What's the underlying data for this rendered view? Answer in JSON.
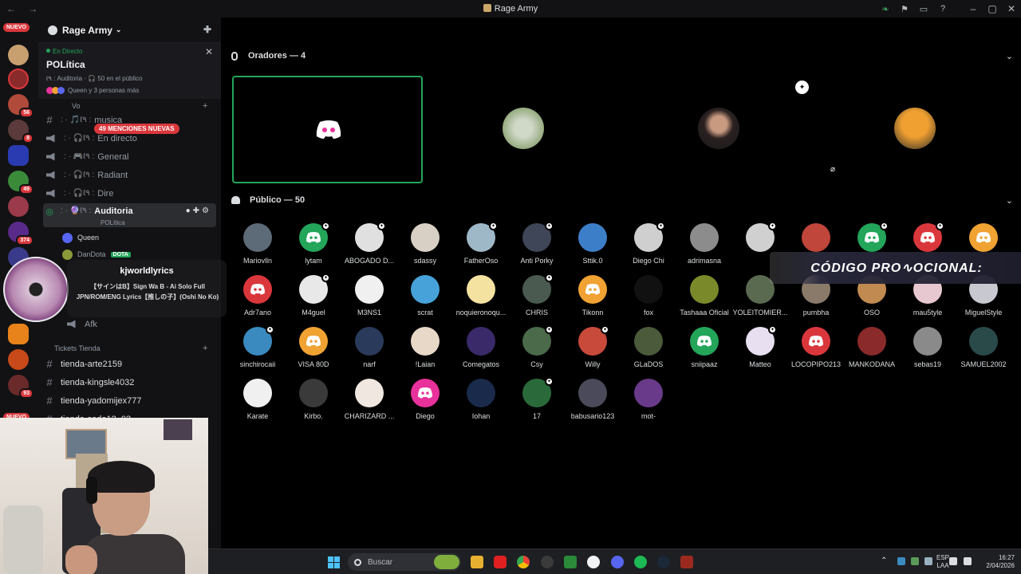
{
  "window": {
    "title": "Rage Army",
    "nav_arrows": "← →"
  },
  "guilds": {
    "nuevo_top": "NUEVO",
    "nuevo_bottom": "NUEVO",
    "badges": [
      "56",
      "8",
      "49",
      "374",
      "93"
    ]
  },
  "server": {
    "name": "Rage Army",
    "live": {
      "tag": "En Directo",
      "name": "POLítica",
      "info": "ℓ٩ : Auditoria · 🎧 50 en el público",
      "people": "Queen y 3 personas más"
    },
    "mentions_badge": "49 MENCIONES NUEVAS",
    "voice_category": "Vo",
    "channels": [
      {
        "prefix": ": · 🎵ℓ٩ :",
        "name": "musica"
      },
      {
        "prefix": ": · 🎧ℓ٩ :",
        "name": "En directo"
      },
      {
        "prefix": ": · 🎮ℓ٩ :",
        "name": "General"
      },
      {
        "prefix": ": · 🎧ℓ٩ :",
        "name": "Radiant"
      },
      {
        "prefix": ": · 🎧ℓ٩ :",
        "name": "Dire"
      },
      {
        "prefix": ": · 🔮ℓ٩ :",
        "name": "Auditoria",
        "sub": "POLítica"
      }
    ],
    "members": [
      {
        "name": "Queen"
      },
      {
        "name": "DanDota",
        "badge": "DOTA"
      }
    ],
    "afk_channel": "Afk",
    "tickets_category": "Tickets Tienda",
    "text_channels": [
      "tienda-arte2159",
      "tienda-kingsle4032",
      "tienda-yadomijex777",
      "tienda-sado12_03"
    ]
  },
  "now_playing": {
    "user": "kjworldlyrics",
    "song": "【サインはB】Sign Wa B - Ai Solo Full JPN/ROM/ENG Lyrics【推しの子】(Oshi No Ko)"
  },
  "stage": {
    "speakers_title": "Oradores — 4",
    "audience_title": "Público — 50",
    "speaker_colors": [
      "#e8319b",
      "#8fa144",
      "#c4aa86",
      "#c85e12"
    ],
    "audience": [
      {
        "name": "Mariovlln",
        "color": "#5d6a78",
        "star": false
      },
      {
        "name": "lytam",
        "color": "#23a55a",
        "star": true,
        "discord": true
      },
      {
        "name": "ABOGADO D...",
        "color": "#e0e0e0",
        "star": true
      },
      {
        "name": "sdassy",
        "color": "#d8d0c4",
        "star": false
      },
      {
        "name": "FatherOso",
        "color": "#9fb8c8",
        "star": true
      },
      {
        "name": "Anti Porky",
        "color": "#3f4658",
        "star": true
      },
      {
        "name": "Sttik.0",
        "color": "#3d7ec9",
        "star": false
      },
      {
        "name": "Diego Chi",
        "color": "#cfcfcf",
        "star": true
      },
      {
        "name": "adrimasna",
        "color": "#8c8c8c",
        "star": false
      },
      {
        "name": "",
        "color": "#d0d0d0",
        "star": true
      },
      {
        "name": "",
        "color": "#c0453a",
        "star": false
      },
      {
        "name": "",
        "color": "#23a55a",
        "star": true,
        "discord": true
      },
      {
        "name": "",
        "color": "#da373c",
        "star": true,
        "discord": true
      },
      {
        "name": "",
        "color": "#f0a232",
        "star": false,
        "discord": true
      },
      {
        "name": "Adr7ano",
        "color": "#da373c",
        "star": false,
        "discord": true
      },
      {
        "name": "M4guel",
        "color": "#e8e8e8",
        "star": true
      },
      {
        "name": "M3NS1",
        "color": "#f0f0f0",
        "star": false
      },
      {
        "name": "scrat",
        "color": "#46a2d8",
        "star": false
      },
      {
        "name": "noquieronoqu...",
        "color": "#f4e2a0",
        "star": false
      },
      {
        "name": "CHRIS",
        "color": "#4a5a50",
        "star": true
      },
      {
        "name": "Tikonn",
        "color": "#f0a232",
        "star": false,
        "discord": true
      },
      {
        "name": "fox",
        "color": "#111111",
        "star": false
      },
      {
        "name": "Tashaaa Oficial",
        "color": "#7a8a2a",
        "star": false
      },
      {
        "name": "YOLEITOMIER...",
        "color": "#5a6a50",
        "star": false
      },
      {
        "name": "pumbha",
        "color": "#8a7a6a",
        "star": false
      },
      {
        "name": "OSO",
        "color": "#c08a50",
        "star": false
      },
      {
        "name": "mau5tyle",
        "color": "#e8c8d0",
        "star": false
      },
      {
        "name": "MiguelStyle",
        "color": "#c8c8d0",
        "star": false
      },
      {
        "name": "sinchirocaii",
        "color": "#3a8ac0",
        "star": true
      },
      {
        "name": "VISA 80D",
        "color": "#f0a232",
        "star": false,
        "discord": true
      },
      {
        "name": "narf",
        "color": "#2a3a5a",
        "star": false
      },
      {
        "name": "!Laian",
        "color": "#e8d8c8",
        "star": false
      },
      {
        "name": "Comegatos",
        "color": "#3a2a6a",
        "star": false
      },
      {
        "name": "Csy",
        "color": "#4a6a4a",
        "star": true
      },
      {
        "name": "Willy",
        "color": "#c84a3a",
        "star": true
      },
      {
        "name": "GLaDOS",
        "color": "#4a5a3a",
        "star": false
      },
      {
        "name": "sniipaaz",
        "color": "#23a55a",
        "star": false,
        "discord": true
      },
      {
        "name": "Matteo",
        "color": "#e8e0f0",
        "star": true
      },
      {
        "name": "LOCOPIPO213",
        "color": "#da373c",
        "star": false,
        "discord": true
      },
      {
        "name": "MANKODANA",
        "color": "#8a2a2a",
        "star": false
      },
      {
        "name": "sebas19",
        "color": "#8a8a8a",
        "star": false
      },
      {
        "name": "SAMUEL2002",
        "color": "#2a4a4a",
        "star": false
      },
      {
        "name": "Karate",
        "color": "#f0f0f0",
        "star": false
      },
      {
        "name": "Kirbo.",
        "color": "#3a3a3a",
        "star": false
      },
      {
        "name": "CHARIZARD ...",
        "color": "#f0e8e0",
        "star": false
      },
      {
        "name": "Diego",
        "color": "#e8319b",
        "star": false,
        "discord": true
      },
      {
        "name": "Iohan",
        "color": "#1a2a4a",
        "star": false
      },
      {
        "name": "17",
        "color": "#2a6a3a",
        "star": true
      },
      {
        "name": "babusario123",
        "color": "#4a4a5a",
        "star": false
      },
      {
        "name": "mot-",
        "color": "#6a3a8a",
        "star": false
      }
    ]
  },
  "promo": "CÓDIGO PRO∿OCIONAL:",
  "taskbar": {
    "search_placeholder": "Buscar",
    "lang_top": "ESP",
    "lang_bottom": "LAA",
    "time": "16:27",
    "date": "2/04/2026"
  },
  "colors": {
    "background": "#000000",
    "sidebar": "#121214",
    "accent_red": "#da373c",
    "accent_green": "#23a55a",
    "discord_blurple": "#5865f2"
  }
}
